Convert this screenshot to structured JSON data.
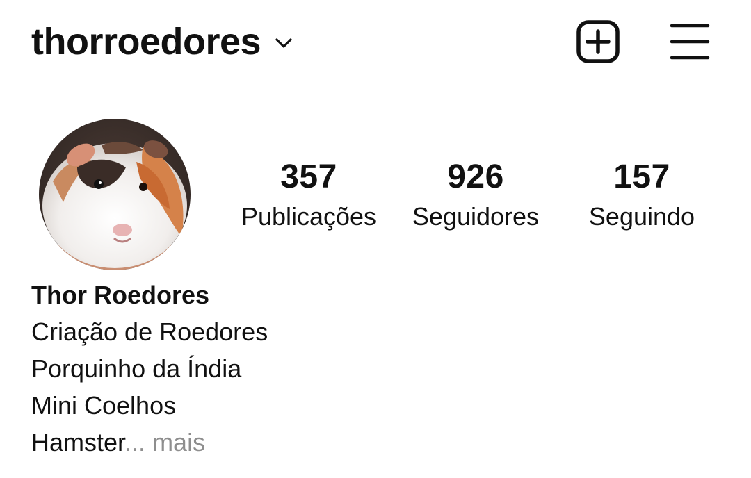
{
  "header": {
    "username": "thorroedores",
    "chevron_icon": "chevron-down-icon",
    "new_post_icon": "plus-square-icon",
    "menu_icon": "hamburger-menu-icon"
  },
  "profile": {
    "avatar_icon": "guinea-pig-profile-photo",
    "stats": {
      "posts_count": "357",
      "posts_label": "Publicações",
      "followers_count": "926",
      "followers_label": "Seguidores",
      "following_count": "157",
      "following_label": "Seguindo"
    },
    "bio": {
      "name": "Thor Roedores",
      "lines": [
        "Criação de Roedores",
        "Porquinho da Índia",
        "Mini Coelhos"
      ],
      "last_line": "Hamster",
      "ellipsis": "...",
      "more_label": " mais"
    }
  },
  "colors": {
    "text": "#111111",
    "muted": "#8e8e8e",
    "background": "#ffffff"
  }
}
